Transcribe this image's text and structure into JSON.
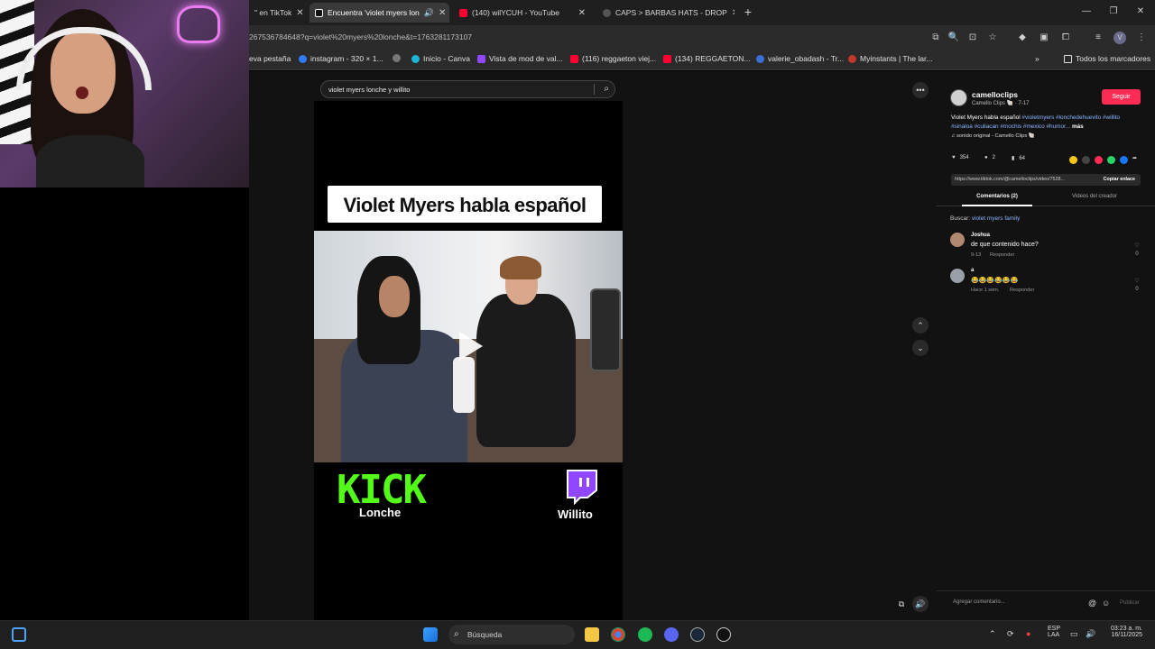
{
  "browser": {
    "tabs": [
      {
        "label": "\" en TikTok",
        "active": false
      },
      {
        "label": "Encuentra 'violet myers lon",
        "active": true
      },
      {
        "label": "(140) wilYCUH - YouTube",
        "active": false
      },
      {
        "label": "CAPS > BARBAS HATS - DROP",
        "active": false
      }
    ],
    "url": "267536784648?q=violet%20myers%20lonche&t=1763281173107",
    "bookmarks": [
      "eva pestaña",
      "instagram - 320 × 1...",
      "Inicio - Canva",
      "Vista de mod de val...",
      "(116) reggaeton viej...",
      "(134) REGGAETON...",
      "valerie_obadash - Tr...",
      "Myinstants | The lar..."
    ],
    "all_bookmarks": "Todos los marcadores"
  },
  "search": {
    "query": "violet myers lonche y willito"
  },
  "video": {
    "title": "Violet Myers habla español",
    "kick_label": "KICK",
    "kick_name": "Lonche",
    "twitch_name": "Willito"
  },
  "creator": {
    "username": "camelloclips",
    "subinfo": "Camello Clips 🐚 · 7-17",
    "follow": "Seguir",
    "desc_text": "Violet Myers habla español ",
    "desc_tags": "#violetmyers #lonchedehuevito #willito #sinaloa #culiacan #mochis #mexico #humor...",
    "more": "más",
    "sound": "♫  sonido original - Camello Clips 🐚"
  },
  "stats": {
    "likes": "354",
    "comments": "2",
    "saves": "64"
  },
  "link": {
    "url": "https://www.tiktok.com/@camelloclips/video/7528...",
    "copy": "Copiar enlace"
  },
  "panel_tabs": {
    "comments": "Comentarios (2)",
    "videos": "Videos del creador"
  },
  "buscar": {
    "label": "Buscar:",
    "query": "violet myers family"
  },
  "comments": [
    {
      "name": "Joshua",
      "text": "de que contenido hace?",
      "date": "9-13",
      "reply": "Responder",
      "likes": "0"
    },
    {
      "name": "a",
      "text": "😂😂😂😂😂😂",
      "date": "Hace 1 sem.",
      "reply": "Responder",
      "likes": "0"
    }
  ],
  "comment_input": {
    "placeholder": "Agregar comentario...",
    "publish": "Publicar"
  },
  "taskbar": {
    "search": "Búsqueda",
    "lang": "ESP",
    "lang2": "LAA",
    "time": "03:23 a. m.",
    "date": "16/11/2025"
  },
  "colors": {
    "accent": "#fe2c55",
    "kick": "#53fc18",
    "twitch": "#9146ff",
    "link": "#8ab4ff"
  }
}
